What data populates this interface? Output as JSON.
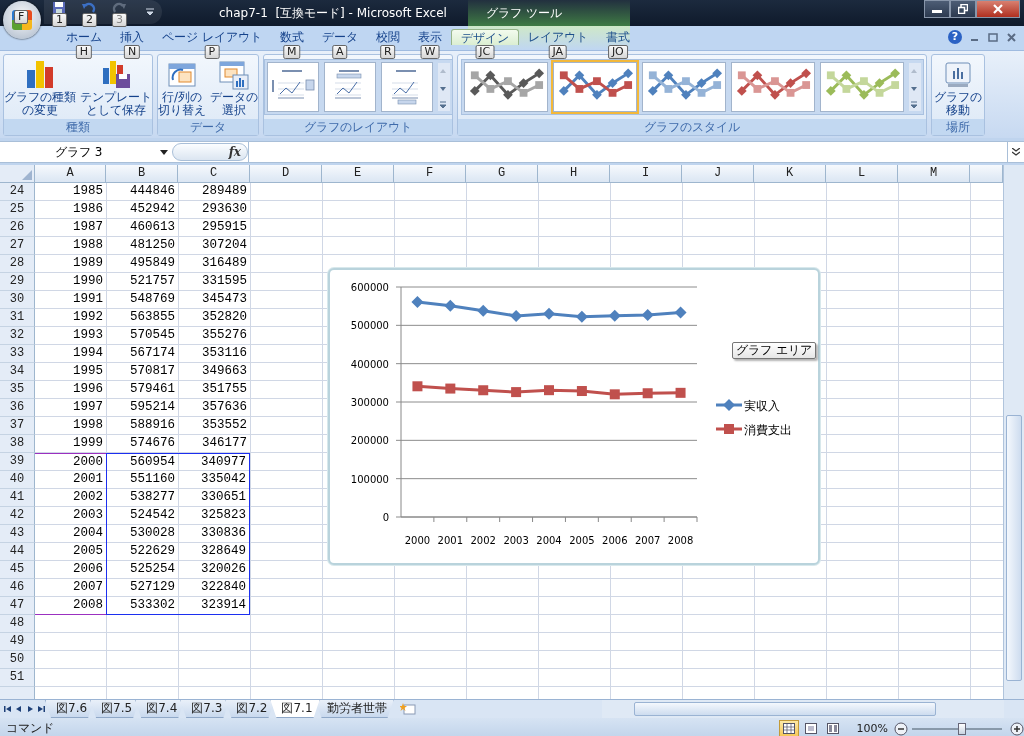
{
  "window": {
    "title": "chap7-1  [互換モード] - Microsoft Excel",
    "context_label": "グラフ ツール"
  },
  "office_button": {
    "keytip": "F"
  },
  "quick_access": [
    {
      "keytip": "1",
      "disabled": false
    },
    {
      "keytip": "2",
      "disabled": false
    },
    {
      "keytip": "3",
      "disabled": true
    }
  ],
  "tabs": [
    {
      "label": "ホーム",
      "keytip": "H",
      "selected": false,
      "contextual": false
    },
    {
      "label": "挿入",
      "keytip": "N",
      "selected": false,
      "contextual": false
    },
    {
      "label": "ページ レイアウト",
      "keytip": "P",
      "selected": false,
      "contextual": false
    },
    {
      "label": "数式",
      "keytip": "M",
      "selected": false,
      "contextual": false
    },
    {
      "label": "データ",
      "keytip": "A",
      "selected": false,
      "contextual": false
    },
    {
      "label": "校閲",
      "keytip": "R",
      "selected": false,
      "contextual": false
    },
    {
      "label": "表示",
      "keytip": "W",
      "selected": false,
      "contextual": false
    },
    {
      "label": "デザイン",
      "keytip": "JC",
      "selected": true,
      "contextual": true
    },
    {
      "label": "レイアウト",
      "keytip": "JA",
      "selected": false,
      "contextual": true
    },
    {
      "label": "書式",
      "keytip": "JO",
      "selected": false,
      "contextual": true
    }
  ],
  "help_label": "?",
  "ribbon_groups": [
    {
      "label": "種類",
      "kind": "buttons",
      "buttons": [
        {
          "lines": [
            "グラフの種類",
            "の変更"
          ]
        },
        {
          "lines": [
            "テンプレート",
            "として保存"
          ]
        }
      ]
    },
    {
      "label": "データ",
      "kind": "buttons",
      "buttons": [
        {
          "lines": [
            "行/列の",
            "切り替え"
          ]
        },
        {
          "lines": [
            "データの",
            "選択"
          ]
        }
      ]
    },
    {
      "label": "グラフのレイアウト",
      "kind": "layouts",
      "layouts": [
        {
          "selected": false
        },
        {
          "selected": false
        },
        {
          "selected": false
        }
      ]
    },
    {
      "label": "グラフのスタイル",
      "kind": "styles",
      "styles": [
        {
          "selected": false,
          "lines": [
            {
              "color": "#595959"
            },
            {
              "color": "#a6a6a6"
            }
          ]
        },
        {
          "selected": true,
          "lines": [
            {
              "color": "#4f81bd"
            },
            {
              "color": "#c0504d"
            }
          ]
        },
        {
          "selected": false,
          "lines": [
            {
              "color": "#4f81bd"
            },
            {
              "color": "#95b3d7"
            }
          ]
        },
        {
          "selected": false,
          "lines": [
            {
              "color": "#c0504d"
            },
            {
              "color": "#da9694"
            }
          ]
        },
        {
          "selected": false,
          "lines": [
            {
              "color": "#9bbb59"
            },
            {
              "color": "#c4d79b"
            }
          ]
        }
      ]
    },
    {
      "label": "場所",
      "kind": "buttons",
      "buttons": [
        {
          "lines": [
            "グラフの",
            "移動"
          ]
        }
      ]
    }
  ],
  "formula_bar": {
    "name_box": "グラフ 3",
    "function_label": "fx"
  },
  "columns": [
    "A",
    "B",
    "C",
    "D",
    "E",
    "F",
    "G",
    "H",
    "I",
    "J",
    "K",
    "L",
    "M"
  ],
  "rows": [
    {
      "number": "24",
      "cells": [
        "1985",
        "444846",
        "289489"
      ],
      "in_chart_range": false
    },
    {
      "number": "25",
      "cells": [
        "1986",
        "452942",
        "293630"
      ],
      "in_chart_range": false
    },
    {
      "number": "26",
      "cells": [
        "1987",
        "460613",
        "295915"
      ],
      "in_chart_range": false
    },
    {
      "number": "27",
      "cells": [
        "1988",
        "481250",
        "307204"
      ],
      "in_chart_range": false
    },
    {
      "number": "28",
      "cells": [
        "1989",
        "495849",
        "316489"
      ],
      "in_chart_range": false
    },
    {
      "number": "29",
      "cells": [
        "1990",
        "521757",
        "331595"
      ],
      "in_chart_range": false
    },
    {
      "number": "30",
      "cells": [
        "1991",
        "548769",
        "345473"
      ],
      "in_chart_range": false
    },
    {
      "number": "31",
      "cells": [
        "1992",
        "563855",
        "352820"
      ],
      "in_chart_range": false
    },
    {
      "number": "32",
      "cells": [
        "1993",
        "570545",
        "355276"
      ],
      "in_chart_range": false
    },
    {
      "number": "33",
      "cells": [
        "1994",
        "567174",
        "353116"
      ],
      "in_chart_range": false
    },
    {
      "number": "34",
      "cells": [
        "1995",
        "570817",
        "349663"
      ],
      "in_chart_range": false
    },
    {
      "number": "35",
      "cells": [
        "1996",
        "579461",
        "351755"
      ],
      "in_chart_range": false
    },
    {
      "number": "36",
      "cells": [
        "1997",
        "595214",
        "357636"
      ],
      "in_chart_range": false
    },
    {
      "number": "37",
      "cells": [
        "1998",
        "588916",
        "353552"
      ],
      "in_chart_range": false
    },
    {
      "number": "38",
      "cells": [
        "1999",
        "574676",
        "346177"
      ],
      "in_chart_range": false
    },
    {
      "number": "39",
      "cells": [
        "2000",
        "560954",
        "340977"
      ],
      "in_chart_range": true
    },
    {
      "number": "40",
      "cells": [
        "2001",
        "551160",
        "335042"
      ],
      "in_chart_range": true
    },
    {
      "number": "41",
      "cells": [
        "2002",
        "538277",
        "330651"
      ],
      "in_chart_range": true
    },
    {
      "number": "42",
      "cells": [
        "2003",
        "524542",
        "325823"
      ],
      "in_chart_range": true
    },
    {
      "number": "43",
      "cells": [
        "2004",
        "530028",
        "330836"
      ],
      "in_chart_range": true
    },
    {
      "number": "44",
      "cells": [
        "2005",
        "522629",
        "328649"
      ],
      "in_chart_range": true
    },
    {
      "number": "45",
      "cells": [
        "2006",
        "525254",
        "320026"
      ],
      "in_chart_range": true
    },
    {
      "number": "46",
      "cells": [
        "2007",
        "527129",
        "322840"
      ],
      "in_chart_range": true
    },
    {
      "number": "47",
      "cells": [
        "2008",
        "533302",
        "323914"
      ],
      "in_chart_range": true
    },
    {
      "number": "48",
      "in_chart_range": false
    },
    {
      "number": "49",
      "in_chart_range": false
    },
    {
      "number": "50",
      "in_chart_range": false
    },
    {
      "number": "51",
      "in_chart_range": false
    }
  ],
  "chart": {
    "tooltip": "グラフ エリア",
    "chart_data": {
      "type": "line",
      "categories": [
        "2000",
        "2001",
        "2002",
        "2003",
        "2004",
        "2005",
        "2006",
        "2007",
        "2008"
      ],
      "series": [
        {
          "name": "実収入",
          "color": "#4f81bd",
          "marker": "diamond",
          "values": [
            560954,
            551160,
            538277,
            524542,
            530028,
            522629,
            525254,
            527129,
            533302
          ]
        },
        {
          "name": "消費支出",
          "color": "#c0504d",
          "marker": "square",
          "values": [
            340977,
            335042,
            330651,
            325823,
            330836,
            328649,
            320026,
            322840,
            323914
          ]
        }
      ],
      "ylim": [
        0,
        600000
      ],
      "yticks": [
        0,
        100000,
        200000,
        300000,
        400000,
        500000,
        600000
      ],
      "grid": true,
      "legend": true
    }
  },
  "sheet_tabs": [
    {
      "label": "図7.6",
      "selected": false
    },
    {
      "label": "図7.5",
      "selected": false
    },
    {
      "label": "図7.4",
      "selected": false
    },
    {
      "label": "図7.3",
      "selected": false
    },
    {
      "label": "図7.2",
      "selected": false
    },
    {
      "label": "図7.1",
      "selected": true
    },
    {
      "label": "勤労者世帯",
      "selected": false
    }
  ],
  "status_bar": {
    "mode": "コマンド",
    "views": [
      {
        "kind": "normal",
        "selected": true
      },
      {
        "kind": "page_layout",
        "selected": false
      },
      {
        "kind": "page_break",
        "selected": false
      }
    ],
    "zoom": "100%",
    "zoom_slider": {
      "level": 0.55
    }
  }
}
